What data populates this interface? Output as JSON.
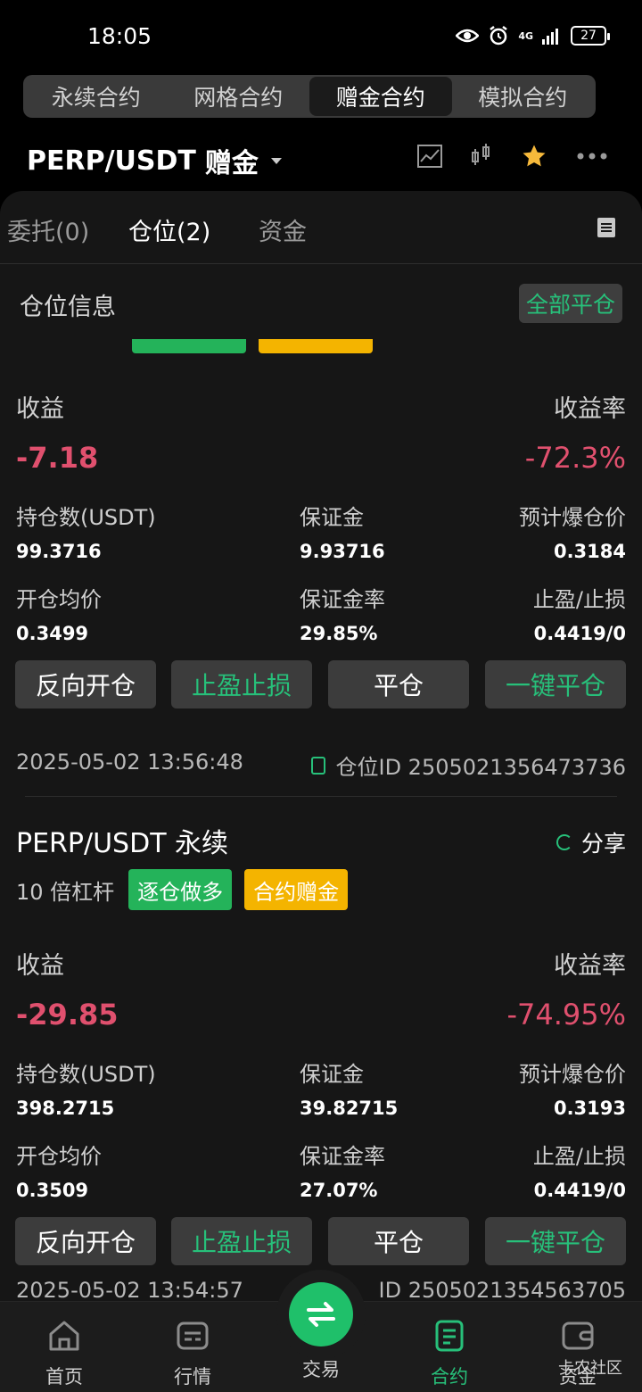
{
  "status_bar": {
    "time": "18:05",
    "network": "4G",
    "battery": "27"
  },
  "top_tabs": [
    "永续合约",
    "网格合约",
    "赠金合约",
    "模拟合约"
  ],
  "symbol": {
    "pair": "PERP/USDT",
    "mode": "赠金"
  },
  "sub_tabs": [
    "委托(0)",
    "仓位(2)",
    "资金"
  ],
  "section": {
    "title": "仓位信息",
    "close_all": "全部平仓"
  },
  "labels": {
    "pnl": "收益",
    "pnl_rate": "收益率",
    "position_size": "持仓数(USDT)",
    "margin": "保证金",
    "liq_price": "预计爆仓价",
    "entry_price": "开仓均价",
    "margin_rate": "保证金率",
    "tp_sl": "止盈/止损",
    "share": "分享",
    "position_id_prefix": "仓位ID"
  },
  "buttons": {
    "reverse": "反向开仓",
    "tpsl": "止盈止损",
    "close": "平仓",
    "one_click_close": "一键平仓"
  },
  "positions": [
    {
      "pnl": "-7.18",
      "pnl_rate": "-72.3%",
      "position_size": "99.3716",
      "margin": "9.93716",
      "liq_price": "0.3184",
      "entry_price": "0.3499",
      "margin_rate": "29.85%",
      "tp_sl": "0.4419/0",
      "time": "2025-05-02 13:56:48",
      "position_id": "仓位ID 2505021356473736"
    },
    {
      "symbol": "PERP/USDT 永续",
      "leverage": "10 倍杠杆",
      "side": "逐仓做多",
      "type": "合约赠金",
      "pnl": "-29.85",
      "pnl_rate": "-74.95%",
      "position_size": "398.2715",
      "margin": "39.82715",
      "liq_price": "0.3193",
      "entry_price": "0.3509",
      "margin_rate": "27.07%",
      "tp_sl": "0.4419/0",
      "time": "2025-05-02 13:54:57",
      "position_id": "ID 2505021354563705"
    }
  ],
  "bottom_nav": [
    "首页",
    "行情",
    "交易",
    "合约",
    "资金"
  ],
  "watermark": "卡农社区",
  "colors": {
    "accent": "#27c07a",
    "loss": "#e0506e",
    "badge_yellow": "#f4b400",
    "badge_green": "#24b35a"
  }
}
